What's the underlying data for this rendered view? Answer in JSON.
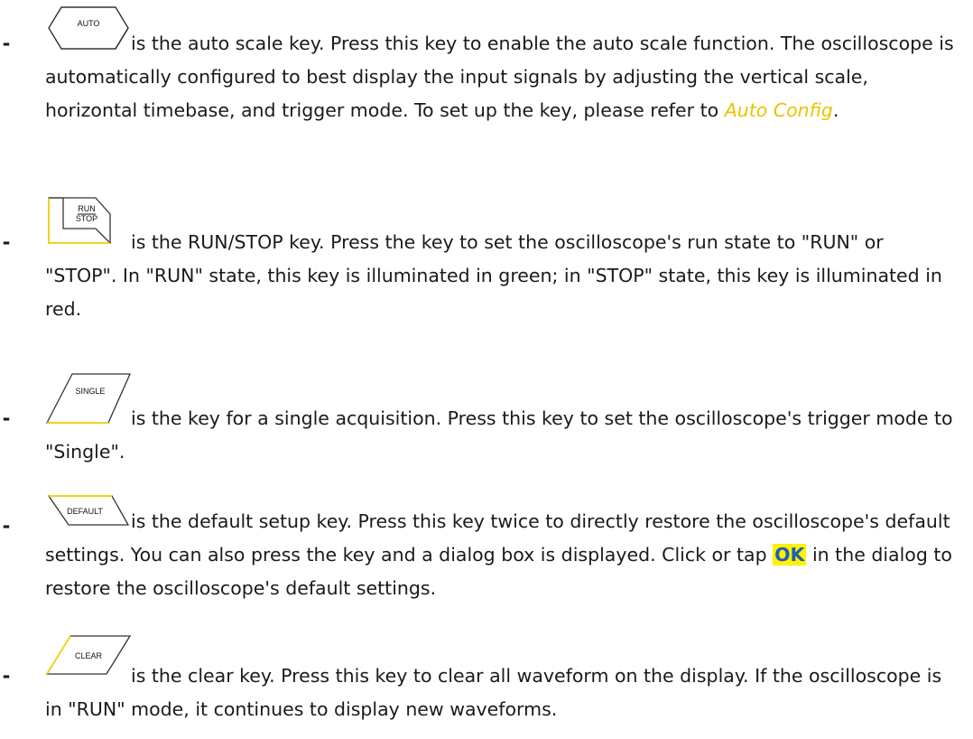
{
  "items": [
    {
      "key_label": "AUTO",
      "text": "is the auto scale key. Press this key to enable the auto scale function. The oscilloscope is automatically configured to best display the input signals by adjusting the vertical scale, horizontal timebase, and trigger mode. To set up the key, please refer to",
      "link": "Auto Config",
      "after": "."
    },
    {
      "key_label_1": "RUN",
      "key_label_2": "STOP",
      "text": "is the RUN/STOP key. Press the key to set the oscilloscope's run state to \"RUN\" or \"STOP\". In \"RUN\" state, this key is illuminated in green; in \"STOP\" state, this key is illuminated in red."
    },
    {
      "key_label": "SINGLE",
      "text": "is the key for a single acquisition. Press this key to set the oscilloscope's trigger mode to \"Single\"."
    },
    {
      "key_label": "DEFAULT",
      "text_before": "is the default setup key. Press this key twice to directly restore the oscilloscope's default settings. You can also press the key and a dialog box is displayed. Click or tap",
      "highlight": "OK",
      "text_after": "in the dialog to restore the oscilloscope's default settings."
    },
    {
      "key_label": "CLEAR",
      "text": "is the clear key. Press this key to clear all waveform on the display. If the oscilloscope is in \"RUN\" mode, it continues to display new waveforms."
    }
  ],
  "dash": "-",
  "colors": {
    "link": "#e8c400",
    "highlight_bg": "#fff200",
    "highlight_text": "#1f5fb4",
    "key_accent": "#f2d21b"
  }
}
